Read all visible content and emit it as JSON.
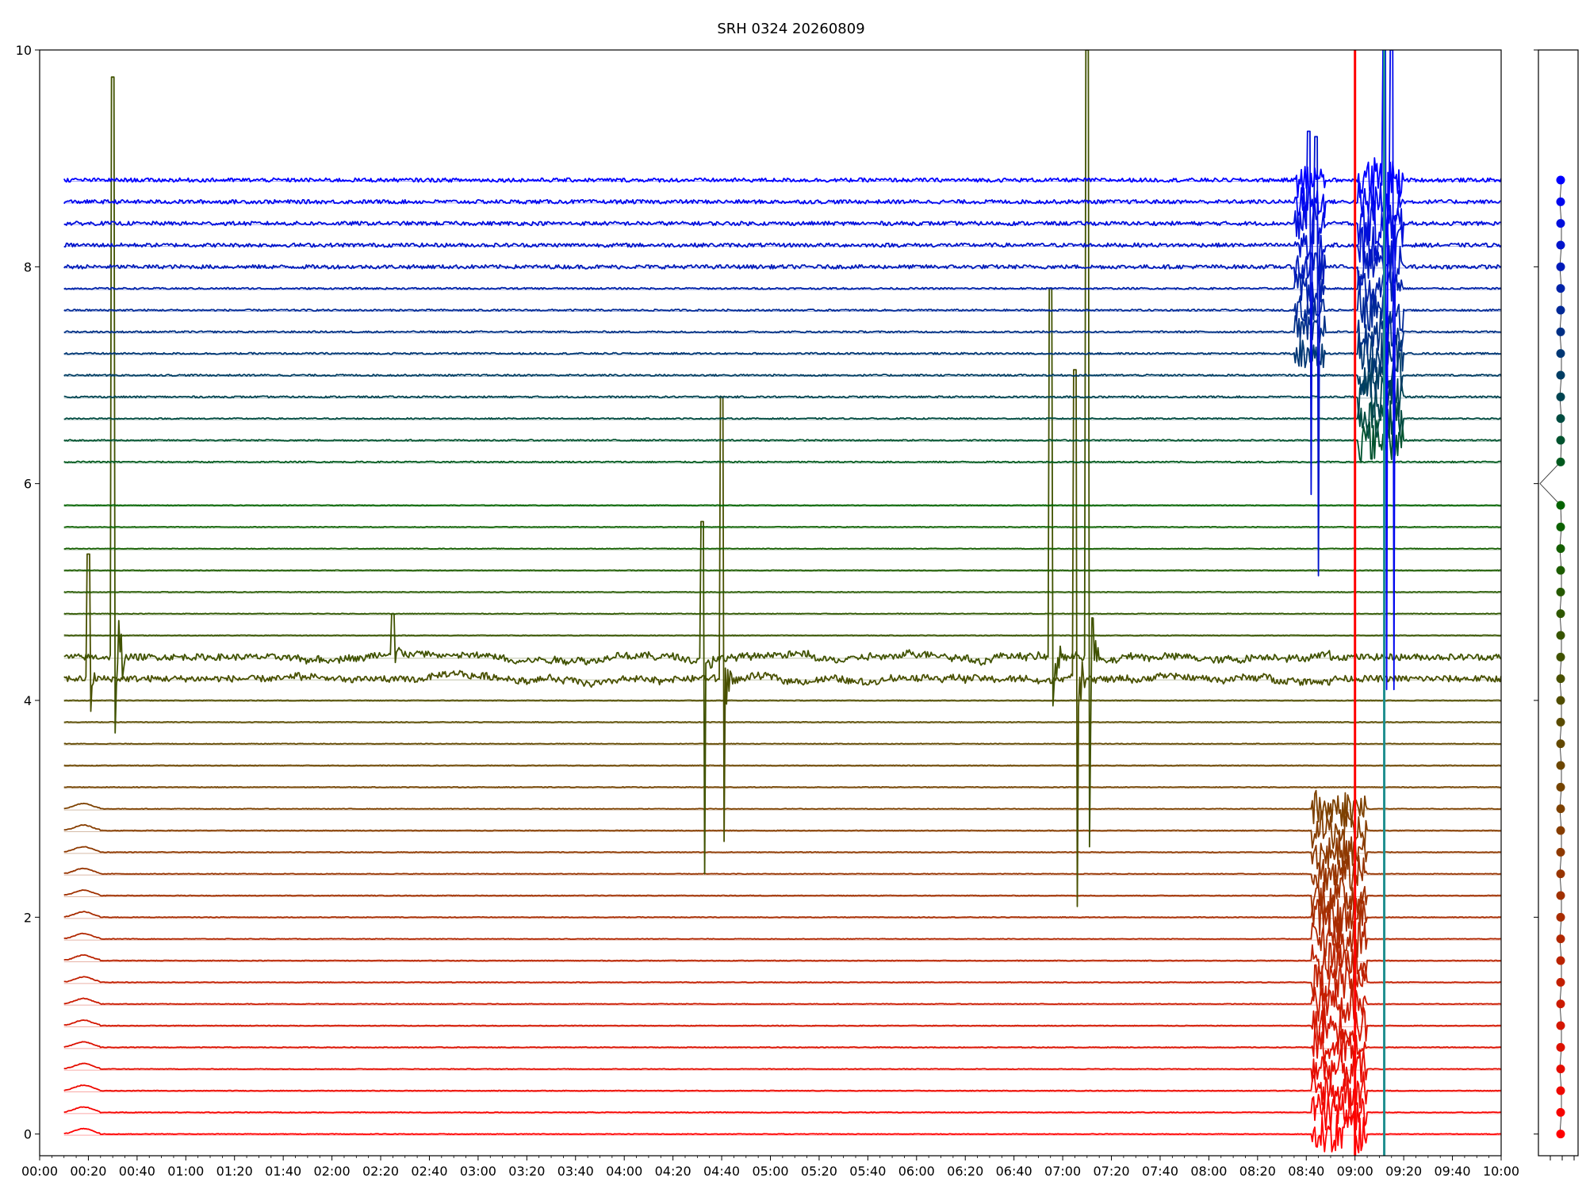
{
  "chart_data": {
    "type": "line",
    "title": "SRH 0324 20260809",
    "xlabel": "",
    "ylabel": "",
    "xlim": [
      "00:00",
      "10:00"
    ],
    "ylim": [
      -0.2,
      10
    ],
    "grid": false,
    "x_ticks": [
      "00:00",
      "00:20",
      "00:40",
      "01:00",
      "01:20",
      "01:40",
      "02:00",
      "02:20",
      "02:40",
      "03:00",
      "03:20",
      "03:40",
      "04:00",
      "04:20",
      "04:40",
      "05:00",
      "05:20",
      "05:40",
      "06:00",
      "06:20",
      "06:40",
      "07:00",
      "07:20",
      "07:40",
      "08:00",
      "08:20",
      "08:40",
      "09:00",
      "09:20",
      "09:40",
      "10:00"
    ],
    "y_ticks": [
      0,
      2,
      4,
      6,
      8,
      10
    ],
    "series_count": 48,
    "series_start_time": "00:10",
    "series_end_time": "10:00",
    "baseline_low": 0.0,
    "baseline_high": 8.8,
    "baseline_step": 0.2,
    "gap_between_offsets": [
      5.8,
      6.2
    ],
    "color_stops": [
      "#ff0000",
      "#804000",
      "#006400",
      "#0000ff"
    ],
    "vertical_markers": [
      {
        "time": "09:00",
        "color": "#ff0000"
      },
      {
        "time": "09:12",
        "color": "#1f8f8f"
      }
    ],
    "events": [
      {
        "time": "00:20",
        "channel_offset": 4.2,
        "peak": 5.35,
        "trough": 3.9
      },
      {
        "time": "00:30",
        "channel_offset": 4.4,
        "peak": 9.75,
        "trough": 3.7
      },
      {
        "time": "02:25",
        "channel_offset": 4.4,
        "peak": 4.8,
        "trough": 4.35
      },
      {
        "time": "04:32",
        "channel_offset": 4.4,
        "peak": 5.65,
        "trough": 2.4
      },
      {
        "time": "04:40",
        "channel_offset": 4.2,
        "peak": 6.8,
        "trough": 2.7
      },
      {
        "time": "06:55",
        "channel_offset": 4.4,
        "peak": 7.8,
        "trough": 3.95
      },
      {
        "time": "07:05",
        "channel_offset": 4.2,
        "peak": 7.05,
        "trough": 2.1
      },
      {
        "time": "07:10",
        "channel_offset": 4.4,
        "peak": 10.0,
        "trough": 2.65
      },
      {
        "time": "08:41",
        "channel_offset": 8.4,
        "peak": 9.25,
        "trough": 5.9
      },
      {
        "time": "08:44",
        "channel_offset": 8.2,
        "peak": 9.2,
        "trough": 5.15
      },
      {
        "time": "09:12",
        "channel_offset": 8.8,
        "peak": 10.0,
        "trough": 4.1
      },
      {
        "time": "09:15",
        "channel_offset": 8.6,
        "peak": 10.0,
        "trough": 4.1
      }
    ],
    "side_panel": {
      "dots_from": 0.0,
      "dots_to": 8.8,
      "dots_step": 0.2,
      "gap_between": [
        5.8,
        6.2
      ]
    }
  }
}
